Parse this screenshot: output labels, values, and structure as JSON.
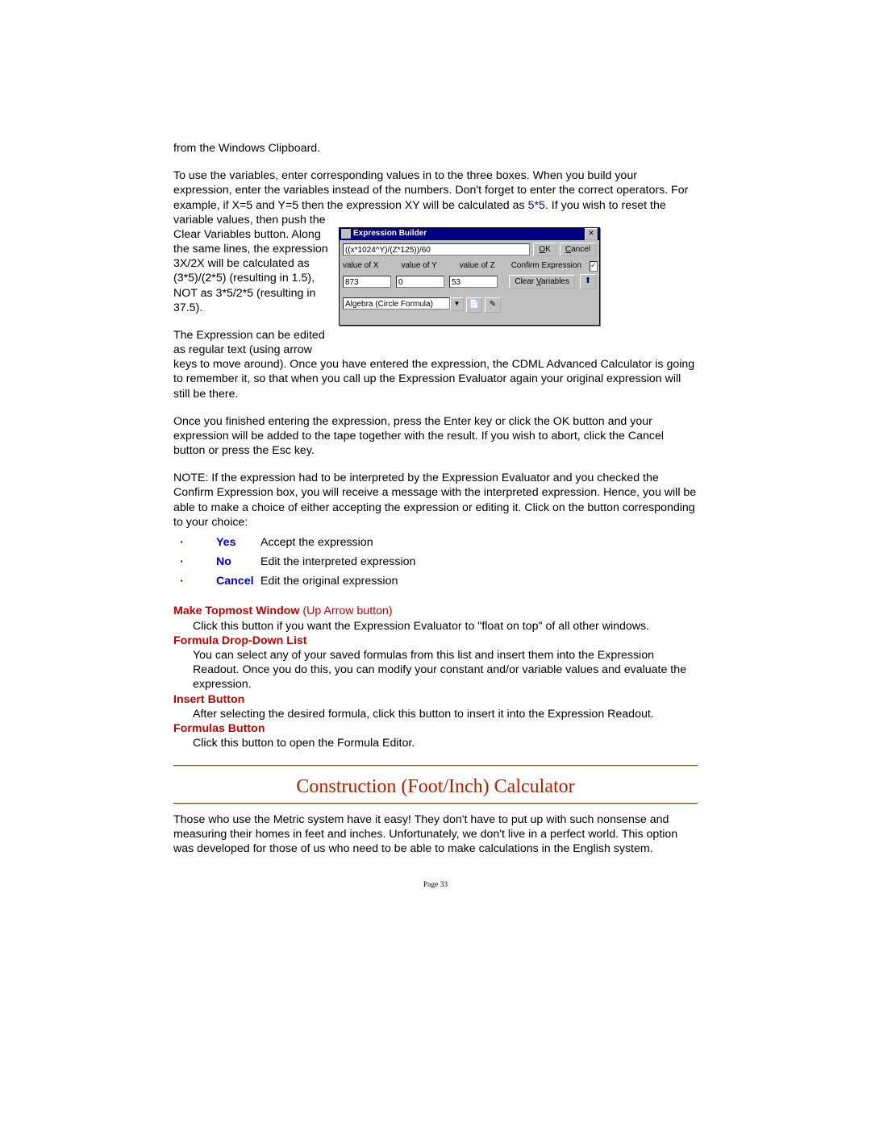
{
  "para": {
    "a": "from the Windows Clipboard.",
    "b1": "To use the variables, enter corresponding values in to the three boxes.  When you build your expression, enter the variables instead of the numbers.  Don't forget to enter the correct  operators.  For example, if X=5 and Y=5 then the expression XY will be calculated as ",
    "b2": "5*5",
    "b3": ".  If you wish to reset the variable values, then push the",
    "c_wrap": "Clear Variables button.  Along the same lines, the expression 3X/2X will be calculated as (3*5)/(2*5) (resulting in 1.5), NOT as 3*5/2*5 (resulting in 37.5).",
    "d_wrap": "The Expression can be edited as regular text (using arrow",
    "d_tail": "keys to move around).  Once you have entered the expression, the CDML Advanced Calculator is going to remember it, so that when you call up the Expression Evaluator again your original expression will still be there.",
    "e": "Once you finished entering the expression, press the Enter key or click the OK button and your expression will be added to the tape together with the result.  If you wish to abort, click the Cancel button or press the Esc key.",
    "f": "NOTE:  If the expression had to be interpreted by the Expression Evaluator and you checked the Confirm Expression box, you will receive a message with the interpreted expression.  Hence, you will be able to make a choice of either accepting the expression or editing it.  Click on the button corresponding to your choice:"
  },
  "choices": [
    {
      "opt": "Yes",
      "desc": "Accept the expression"
    },
    {
      "opt": "No",
      "desc": "Edit the interpreted expression"
    },
    {
      "opt": "Cancel",
      "desc": "Edit the original expression"
    }
  ],
  "sections": {
    "mtw": {
      "title": "Make Topmost Window",
      "sub": " (Up Arrow button)",
      "body": "Click this button if you want the Expression Evaluator to \"float on top\" of all other windows."
    },
    "fdd": {
      "title": "Formula Drop-Down List",
      "body": "You can select any of your saved formulas from this list and insert them into the Expression Readout.  Once you do this, you can modify your constant and/or variable values and evaluate the expression."
    },
    "ins": {
      "title": "Insert Button",
      "body": "After selecting the desired formula, click this button to insert it into the Expression Readout."
    },
    "fbt": {
      "title": "Formulas Button",
      "body": "Click this button to open the Formula Editor."
    }
  },
  "heading": "Construction (Foot/Inch) Calculator",
  "bottom_para": "Those who use the Metric system have it easy!  They don't have to put up with such nonsense and measuring their homes in feet and inches.  Unfortunately, we don't live in a perfect world.  This option was developed for those of us who need to be able to make calculations in the English system.",
  "page_footer": "Page 33",
  "dialog": {
    "title": "Expression Builder",
    "expr": "((x*1024^Y)/(Z*125))/60",
    "ok": "OK",
    "cancel": "Cancel",
    "lbl_x": "value of  X",
    "lbl_y": "value of  Y",
    "lbl_z": "value of  Z",
    "confirm_lbl": "Confirm Expression",
    "confirm_checked": "✓",
    "val_x": "873",
    "val_y": "0",
    "val_z": "53",
    "clear_vars": "Clear Variables",
    "formula_sel": "Algebra (Circle Formula)"
  }
}
